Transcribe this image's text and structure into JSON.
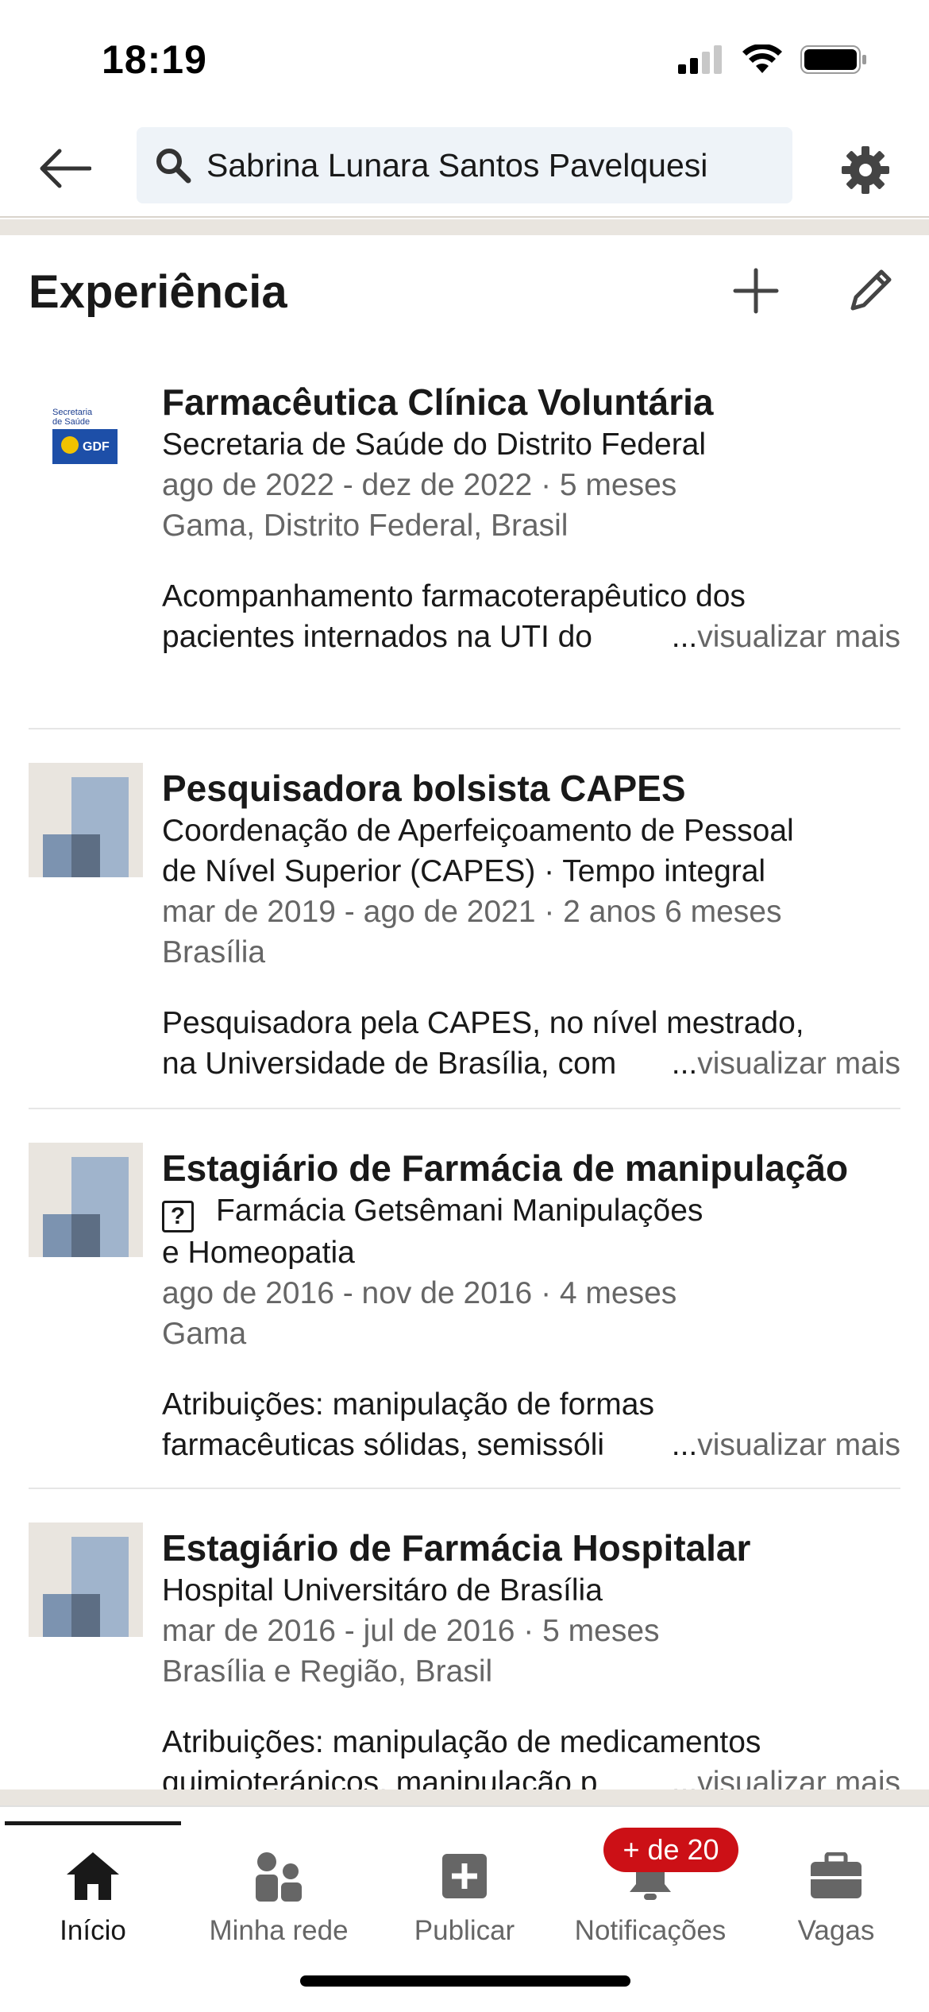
{
  "status_bar": {
    "time": "18:19"
  },
  "header": {
    "search_value": "Sabrina Lunara Santos Pavelquesi"
  },
  "section": {
    "title": "Experiência"
  },
  "experiences": [
    {
      "title": "Farmacêutica Clínica Voluntária",
      "company": "Secretaria de Saúde do Distrito Federal",
      "dates": "ago de 2022 - dez de 2022 · 5 meses",
      "location": "Gama, Distrito Federal, Brasil",
      "desc_line1": "Acompanhamento farmacoterapêutico dos",
      "desc_line2": "pacientes internados na UTI do ",
      "logo_text_top": "Secretaria de Saúde",
      "logo_badge": "GDF"
    },
    {
      "title": "Pesquisadora bolsista CAPES",
      "company_line1": "Coordenação de Aperfeiçoamento de Pessoal",
      "company_line2": "de Nível Superior (CAPES) · Tempo integral",
      "dates": "mar de 2019 - ago de 2021 · 2 anos 6 meses",
      "location": "Brasília",
      "desc_line1": "Pesquisadora pela CAPES, no nível mestrado,",
      "desc_line2": "na Universidade de Brasília, com"
    },
    {
      "title": "Estagiário de Farmácia de manipulação",
      "company_icon": "?",
      "company_line1": "Farmácia Getsêmani Manipulações",
      "company_line2": "e Homeopatia",
      "dates": "ago de 2016 - nov de 2016 · 4 meses",
      "location": "Gama",
      "desc_line1": "Atribuições: manipulação de formas",
      "desc_line2": "farmacêuticas sólidas, semissóli"
    },
    {
      "title": "Estagiário de Farmácia Hospitalar",
      "company": "Hospital Universitáro de Brasília",
      "dates": "mar de 2016 - jul de 2016 · 5 meses",
      "location": "Brasília e Região, Brasil",
      "desc_line1": "Atribuições: manipulação de medicamentos",
      "desc_line2": "quimioterápicos, manipulação p"
    }
  ],
  "see_more": {
    "ellipsis": "...",
    "label": "visualizar mais"
  },
  "nav": {
    "items": [
      {
        "label": "Início",
        "icon": "home-icon"
      },
      {
        "label": "Minha rede",
        "icon": "network-icon"
      },
      {
        "label": "Publicar",
        "icon": "post-icon"
      },
      {
        "label": "Notificações",
        "icon": "bell-icon"
      },
      {
        "label": "Vagas",
        "icon": "briefcase-icon"
      }
    ],
    "badge": "+ de 20"
  },
  "colors": {
    "accent": "#cc1016",
    "muted_text": "#666666",
    "search_bg": "#eef3f8",
    "divider": "#e9e5df"
  }
}
